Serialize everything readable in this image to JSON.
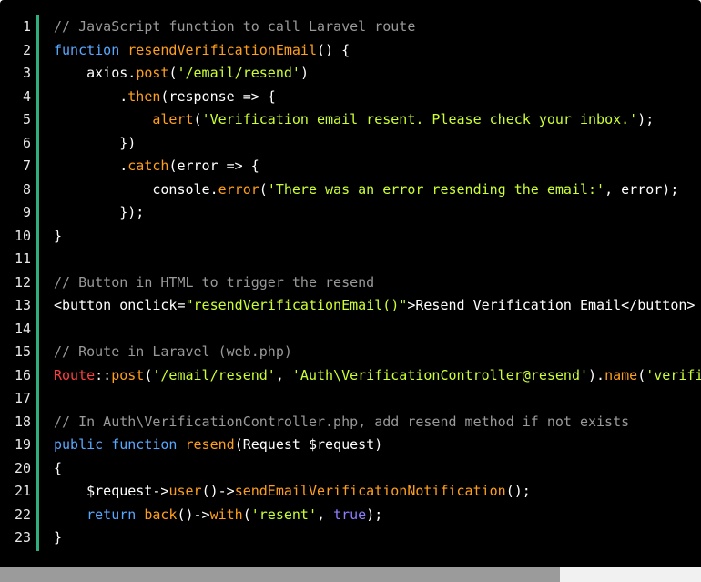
{
  "editor": {
    "line_numbers": [
      "1",
      "2",
      "3",
      "4",
      "5",
      "6",
      "7",
      "8",
      "9",
      "10",
      "11",
      "12",
      "13",
      "14",
      "15",
      "16",
      "17",
      "18",
      "19",
      "20",
      "21",
      "22",
      "23"
    ],
    "lines": [
      [
        [
          "cm",
          "// JavaScript function to call Laravel route"
        ]
      ],
      [
        [
          "kw",
          "function "
        ],
        [
          "fn",
          "resendVerificationEmail"
        ],
        [
          "pl",
          "() {"
        ]
      ],
      [
        [
          "pl",
          "    axios."
        ],
        [
          "fn",
          "post"
        ],
        [
          "pl",
          "("
        ],
        [
          "st",
          "'/email/resend'"
        ],
        [
          "pl",
          ")"
        ]
      ],
      [
        [
          "pl",
          "        ."
        ],
        [
          "fn",
          "then"
        ],
        [
          "pl",
          "(response => {"
        ]
      ],
      [
        [
          "pl",
          "            "
        ],
        [
          "fn",
          "alert"
        ],
        [
          "pl",
          "("
        ],
        [
          "st",
          "'Verification email resent. Please check your inbox.'"
        ],
        [
          "pl",
          ");"
        ]
      ],
      [
        [
          "pl",
          "        })"
        ]
      ],
      [
        [
          "pl",
          "        ."
        ],
        [
          "fn",
          "catch"
        ],
        [
          "pl",
          "(error => {"
        ]
      ],
      [
        [
          "pl",
          "            console."
        ],
        [
          "fn",
          "error"
        ],
        [
          "pl",
          "("
        ],
        [
          "st",
          "'There was an error resending the email:'"
        ],
        [
          "pl",
          ", error);"
        ]
      ],
      [
        [
          "pl",
          "        });"
        ]
      ],
      [
        [
          "pl",
          "}"
        ]
      ],
      [
        [
          "pl",
          ""
        ]
      ],
      [
        [
          "cm",
          "// Button in HTML to trigger the resend"
        ]
      ],
      [
        [
          "pl",
          "<button onclick="
        ],
        [
          "st",
          "\"resendVerificationEmail()\""
        ],
        [
          "pl",
          ">Resend Verification Email</button>"
        ]
      ],
      [
        [
          "pl",
          ""
        ]
      ],
      [
        [
          "cm",
          "// Route in Laravel (web.php)"
        ]
      ],
      [
        [
          "rt",
          "Route"
        ],
        [
          "pl",
          "::"
        ],
        [
          "fn",
          "post"
        ],
        [
          "pl",
          "("
        ],
        [
          "st",
          "'/email/resend'"
        ],
        [
          "pl",
          ", "
        ],
        [
          "st",
          "'Auth\\VerificationController@resend'"
        ],
        [
          "pl",
          ")."
        ],
        [
          "fn",
          "name"
        ],
        [
          "pl",
          "("
        ],
        [
          "st",
          "'verification.resend'"
        ],
        [
          "pl",
          ");"
        ]
      ],
      [
        [
          "pl",
          ""
        ]
      ],
      [
        [
          "cm",
          "// In Auth\\VerificationController.php, add resend method if not exists"
        ]
      ],
      [
        [
          "kw",
          "public "
        ],
        [
          "kw",
          "function "
        ],
        [
          "fn",
          "resend"
        ],
        [
          "pl",
          "(Request $request)"
        ]
      ],
      [
        [
          "pl",
          "{"
        ]
      ],
      [
        [
          "pl",
          "    $request->"
        ],
        [
          "fn",
          "user"
        ],
        [
          "pl",
          "()->"
        ],
        [
          "fn",
          "sendEmailVerificationNotification"
        ],
        [
          "pl",
          "();"
        ]
      ],
      [
        [
          "pl",
          "    "
        ],
        [
          "kw",
          "return "
        ],
        [
          "fn",
          "back"
        ],
        [
          "pl",
          "()->"
        ],
        [
          "fn",
          "with"
        ],
        [
          "pl",
          "("
        ],
        [
          "st",
          "'resent'"
        ],
        [
          "pl",
          ", "
        ],
        [
          "bi",
          "true"
        ],
        [
          "pl",
          ");"
        ]
      ],
      [
        [
          "pl",
          "}"
        ]
      ]
    ]
  },
  "colors": {
    "background": "#000000",
    "comment": "#999999",
    "keyword": "#57a8ff",
    "function": "#ff9f1c",
    "string": "#ccff33",
    "route_class": "#ff4040",
    "boolean": "#8f7dff",
    "gutter_rule": "#2fae7f"
  }
}
